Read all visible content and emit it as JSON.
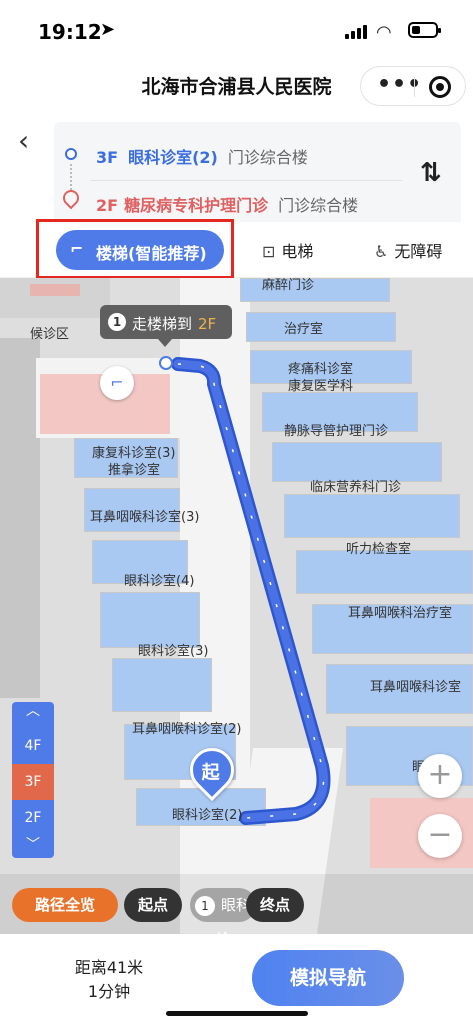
{
  "status_bar": {
    "time": "19:12"
  },
  "title_bar": {
    "title": "北海市合浦县人民医院",
    "more_icon": "more-dots-icon",
    "close_icon": "target-ring-icon"
  },
  "route": {
    "start": {
      "floor": "3F",
      "room": "眼科诊室(2)",
      "building": "门诊综合楼"
    },
    "end": {
      "floor": "2F",
      "room": "糖尿病专科护理门诊",
      "building": "门诊综合楼"
    }
  },
  "modes": {
    "stairs": "楼梯(智能推荐)",
    "elevator": "电梯",
    "accessible": "无障碍"
  },
  "map": {
    "instruction": {
      "step": "1",
      "text": "走楼梯到",
      "target": "2F"
    },
    "labels": {
      "waiting": "候诊区",
      "partial_top": "麻醉门诊",
      "treatment": "治疗室",
      "pain": "疼痛科诊室",
      "rehab_sci": "康复医学科",
      "iv": "静脉导管护理门诊",
      "rehab_room": "康复科诊室(3)",
      "massage": "推拿诊室",
      "nutrition": "临床营养科门诊",
      "ent3": "耳鼻咽喉科诊室(3)",
      "hearing": "听力检查室",
      "eye4": "眼科诊室(4)",
      "ent_treat": "耳鼻咽喉科治疗室",
      "eye3": "眼科诊室(3)",
      "ent_room": "耳鼻咽喉科诊室",
      "ent2": "耳鼻咽喉科诊室(2)",
      "eye2": "眼科诊室(2)",
      "partial_right": "眼"
    },
    "start_marker": "起",
    "floors": [
      "4F",
      "3F",
      "2F"
    ],
    "current_floor": "3F",
    "zoom_in": "+",
    "zoom_out": "−"
  },
  "chips": {
    "overview": "路径全览",
    "start": "起点",
    "step_num": "1",
    "partial": "眼科诊",
    "end": "终点"
  },
  "bottom": {
    "distance": "距离41米",
    "duration": "1分钟",
    "nav_button": "模拟导航"
  },
  "colors": {
    "accent": "#4e7be8",
    "route": "#3a63d8",
    "current_floor": "#e1684a",
    "overview_chip": "#e8722a",
    "highlight_box": "#e4271f"
  }
}
